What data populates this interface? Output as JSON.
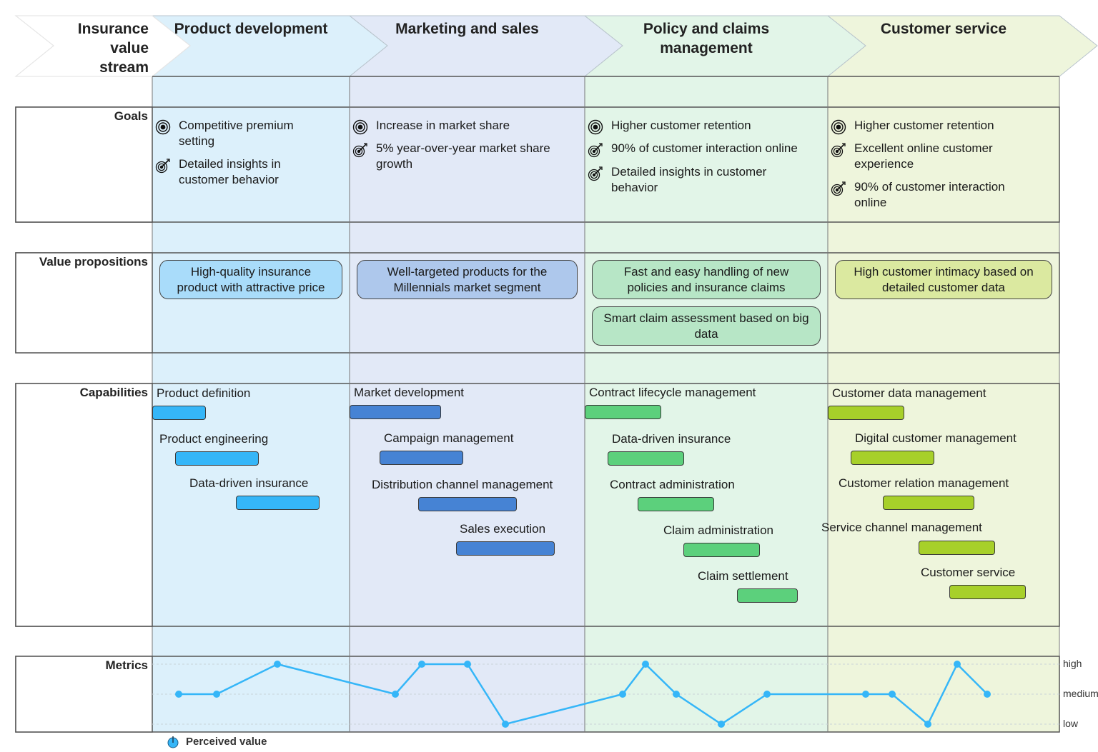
{
  "header": {
    "stream_label": "Insurance value stream",
    "stream_label_lines": [
      "Insurance",
      "value",
      "stream"
    ],
    "stages": [
      {
        "title_lines": [
          "Product development"
        ],
        "color": "#dcf0fb"
      },
      {
        "title_lines": [
          "Marketing and sales"
        ],
        "color": "#e2e9f7"
      },
      {
        "title_lines": [
          "Policy and claims",
          "management"
        ],
        "color": "#e2f5e8"
      },
      {
        "title_lines": [
          "Customer service"
        ],
        "color": "#eef5dc"
      }
    ]
  },
  "rows": {
    "goals": "Goals",
    "value_propositions": "Value propositions",
    "capabilities": "Capabilities",
    "metrics": "Metrics"
  },
  "goals": [
    [
      {
        "icon": "goal-target-icon",
        "lines": [
          "Competitive premium",
          "setting"
        ]
      },
      {
        "icon": "objective-dart-icon",
        "lines": [
          "Detailed insights in",
          "customer behavior"
        ]
      }
    ],
    [
      {
        "icon": "goal-target-icon",
        "lines": [
          "Increase in market share"
        ]
      },
      {
        "icon": "objective-dart-icon",
        "lines": [
          "5% year-over-year market share",
          "growth"
        ]
      }
    ],
    [
      {
        "icon": "goal-target-icon",
        "lines": [
          "Higher customer retention"
        ]
      },
      {
        "icon": "objective-dart-icon",
        "lines": [
          "90% of customer interaction online"
        ]
      },
      {
        "icon": "objective-dart-icon",
        "lines": [
          "Detailed insights in customer",
          "behavior"
        ]
      }
    ],
    [
      {
        "icon": "goal-target-icon",
        "lines": [
          "Higher customer retention"
        ]
      },
      {
        "icon": "objective-dart-icon",
        "lines": [
          "Excellent online customer",
          "experience"
        ]
      },
      {
        "icon": "objective-dart-icon",
        "lines": [
          "90% of customer interaction",
          "online"
        ]
      }
    ]
  ],
  "value_propositions": [
    [
      {
        "lines": [
          "High-quality insurance",
          "product with attractive price"
        ],
        "color": "#a9dcfa"
      }
    ],
    [
      {
        "lines": [
          "Well-targeted products for the",
          "Millennials market segment"
        ],
        "color": "#aec8ec"
      }
    ],
    [
      {
        "lines": [
          "Fast and easy handling of new",
          "policies and insurance claims"
        ],
        "color": "#b7e6c6"
      },
      {
        "lines": [
          "Smart claim assessment based on big",
          "data"
        ],
        "color": "#b7e6c6"
      }
    ],
    [
      {
        "lines": [
          "High customer intimacy based on",
          "detailed customer data"
        ],
        "color": "#dbe9a0"
      }
    ]
  ],
  "capabilities": [
    {
      "color": "#35b6f8",
      "items": [
        "Product definition",
        "Product engineering",
        "Data-driven insurance"
      ]
    },
    {
      "color": "#4683d4",
      "items": [
        "Market development",
        "Campaign management",
        "Distribution channel management",
        "Sales execution"
      ]
    },
    {
      "color": "#5cd07c",
      "items": [
        "Contract lifecycle management",
        "Data-driven insurance",
        "Contract administration",
        "Claim administration",
        "Claim settlement"
      ]
    },
    {
      "color": "#a7d02a",
      "items": [
        "Customer data management",
        "Digital customer management",
        "Customer relation management",
        "Service channel management",
        "Customer service"
      ]
    }
  ],
  "chart_data": {
    "type": "line",
    "title": "Metrics",
    "series": [
      {
        "name": "Perceived value",
        "color": "#35b6f8",
        "values": [
          "medium",
          "medium",
          "high",
          "medium",
          "high",
          "high",
          "low",
          "medium",
          "high",
          "medium",
          "low",
          "medium",
          "medium",
          "medium",
          "low",
          "high",
          "medium"
        ],
        "stage": [
          0,
          0,
          0,
          1,
          1,
          1,
          1,
          2,
          2,
          2,
          2,
          2,
          3,
          3,
          3,
          3,
          3
        ]
      }
    ],
    "y_levels": [
      "low",
      "medium",
      "high"
    ],
    "legend": "bottom-left",
    "grid": true
  },
  "legend": {
    "label": "Perceived value"
  }
}
